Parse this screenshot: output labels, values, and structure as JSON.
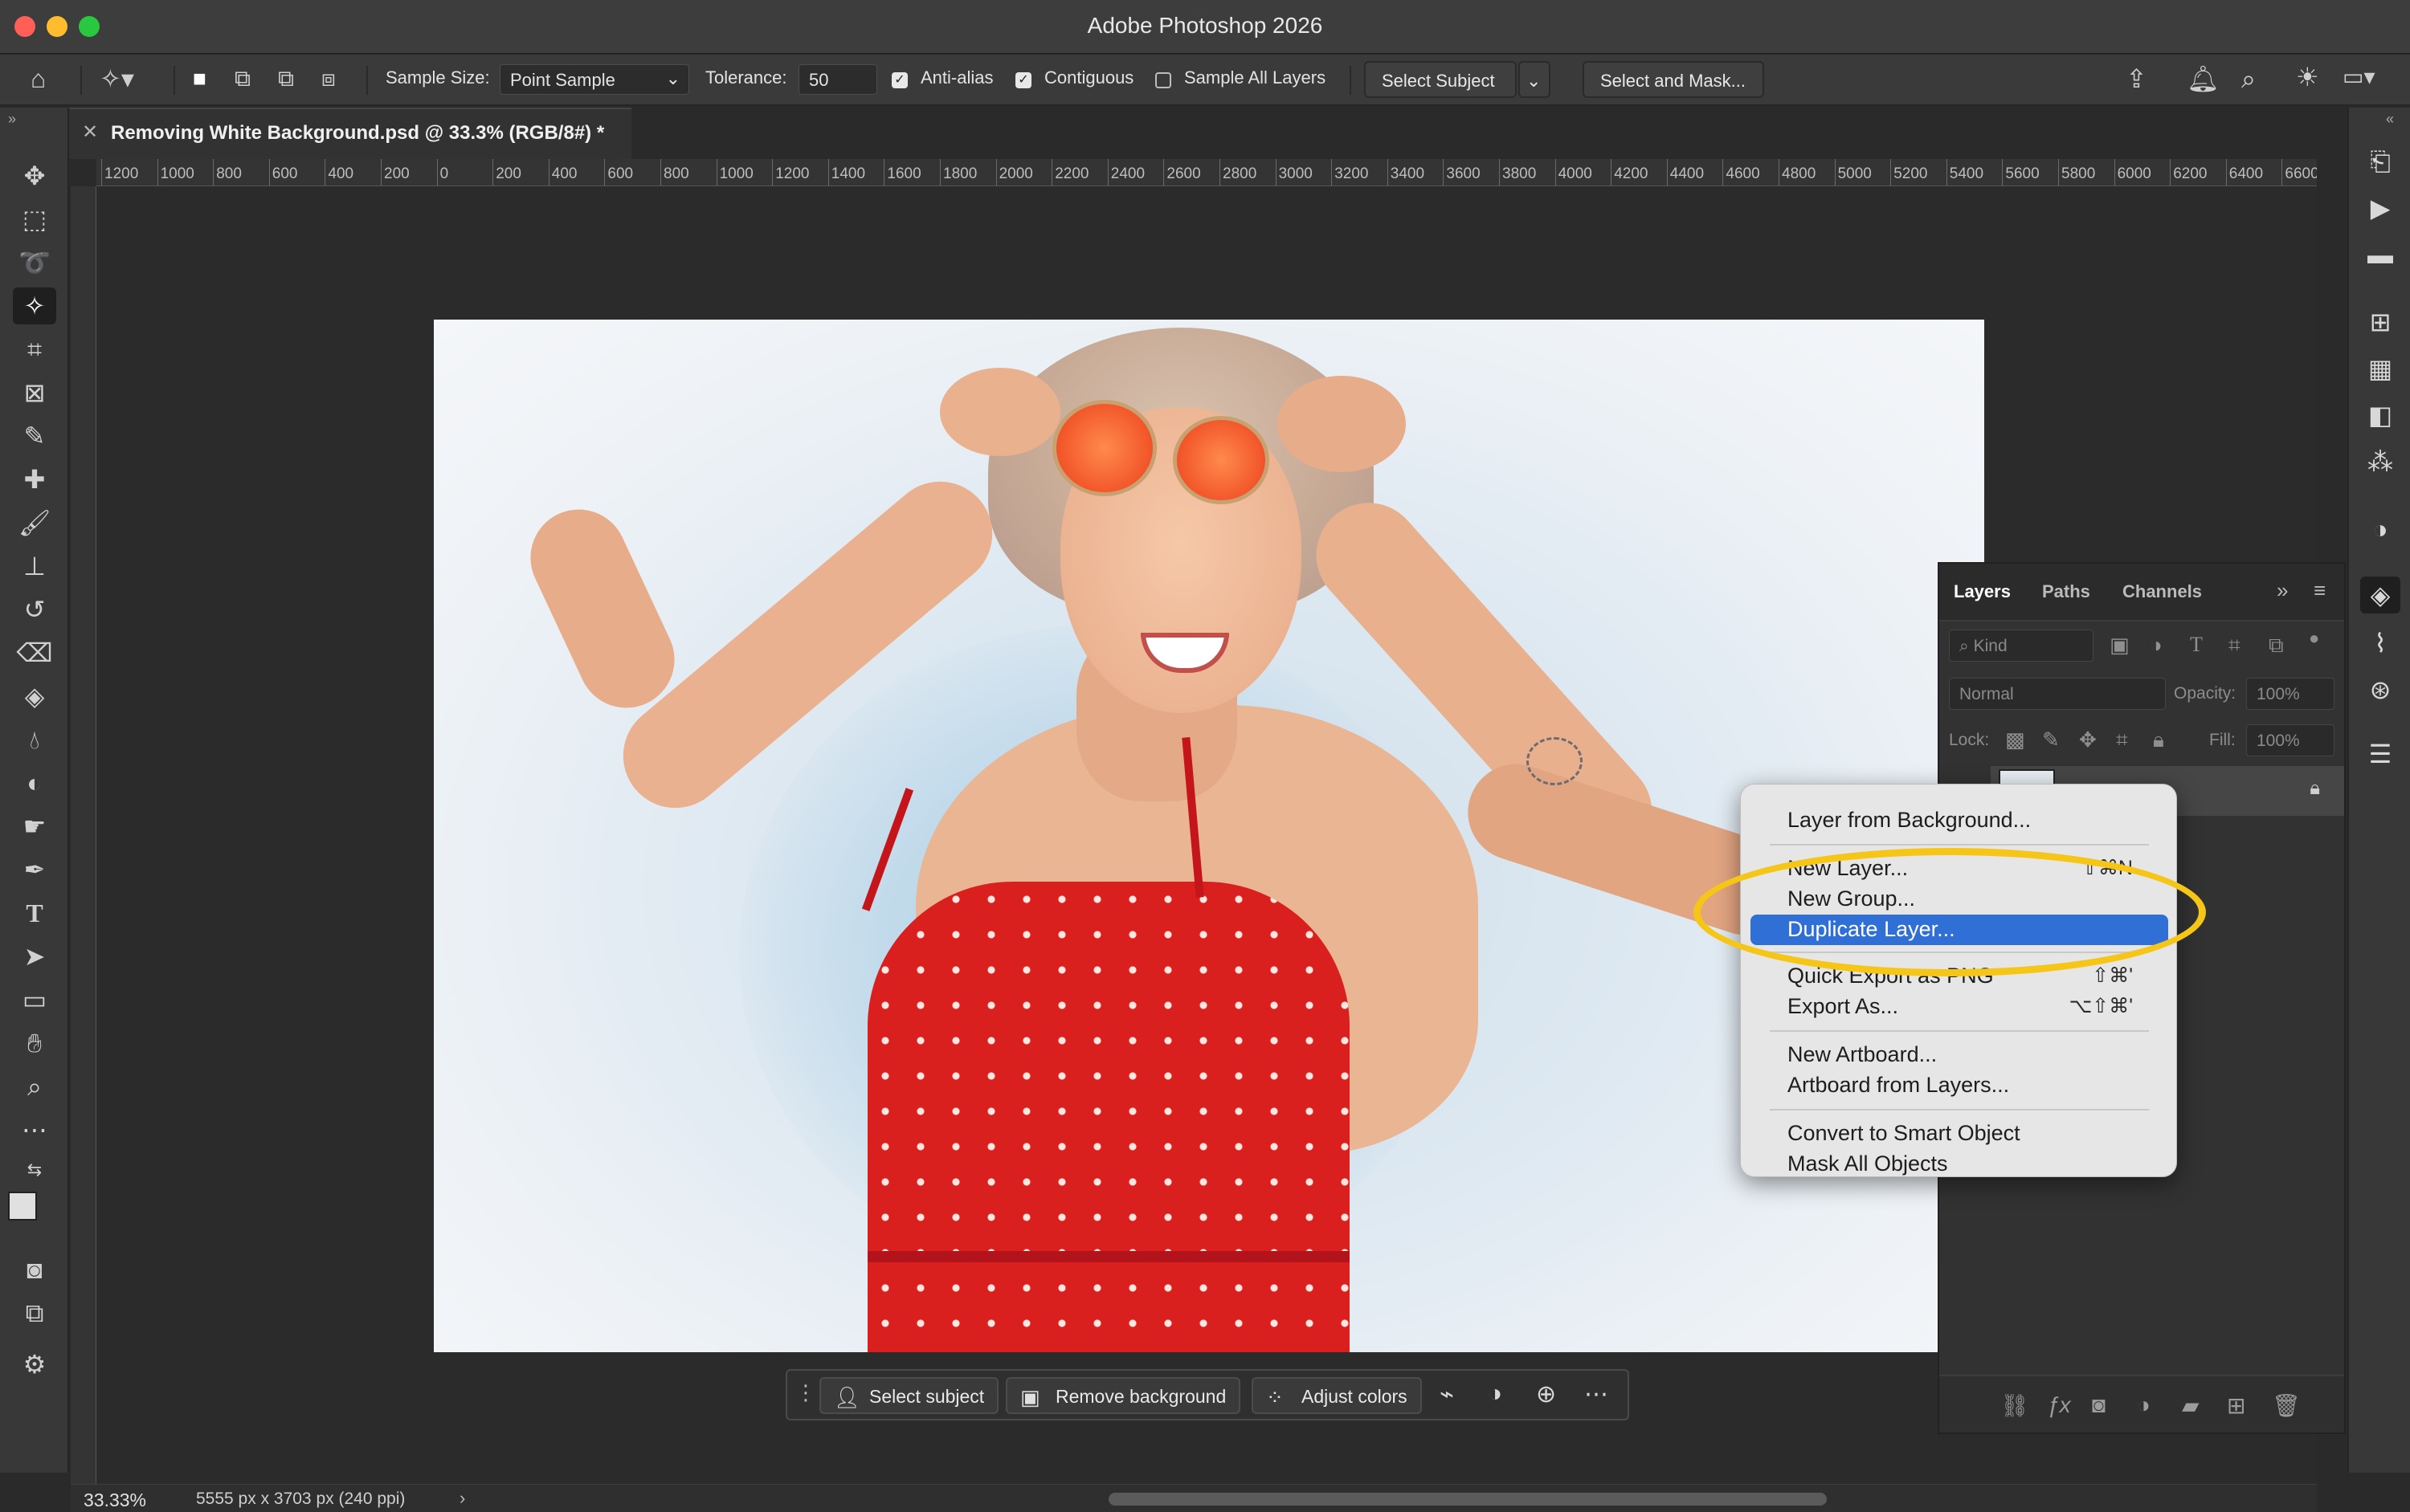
{
  "window": {
    "title": "Adobe Photoshop 2026",
    "traffic_colors": [
      "#ff5f57",
      "#febc2e",
      "#28c840"
    ]
  },
  "options_bar": {
    "sample_size_label": "Sample Size:",
    "sample_size_value": "Point Sample",
    "tolerance_label": "Tolerance:",
    "tolerance_value": "50",
    "anti_alias_label": "Anti-alias",
    "contiguous_label": "Contiguous",
    "sample_all_layers_label": "Sample All Layers",
    "select_subject_label": "Select Subject",
    "select_and_mask_label": "Select and Mask..."
  },
  "document": {
    "tab_title": "Removing White Background.psd @ 33.3% (RGB/8#) *"
  },
  "ruler": {
    "ticks": [
      "1200",
      "1000",
      "800",
      "600",
      "400",
      "200",
      "0",
      "200",
      "400",
      "600",
      "800",
      "1000",
      "1200",
      "1400",
      "1600",
      "1800",
      "2000",
      "2200",
      "2400",
      "2600",
      "2800",
      "3000",
      "3200",
      "3400",
      "3600",
      "3800",
      "4000",
      "4200",
      "4400",
      "4600",
      "4800",
      "5000",
      "5200",
      "5400",
      "5600",
      "5800",
      "6000",
      "6200",
      "6400",
      "6600"
    ]
  },
  "taskbar": {
    "select_subject": "Select subject",
    "remove_background": "Remove background",
    "adjust_colors": "Adjust colors"
  },
  "status": {
    "zoom": "33.33%",
    "doc_size": "5555 px x 3703 px (240 ppi)"
  },
  "layers_panel": {
    "tabs": [
      "Layers",
      "Paths",
      "Channels"
    ],
    "kind_placeholder": "Kind",
    "blend_mode": "Normal",
    "opacity_label": "Opacity:",
    "opacity_value": "100%",
    "lock_label": "Lock:",
    "fill_label": "Fill:",
    "fill_value": "100%"
  },
  "context_menu": {
    "items": [
      {
        "label": "Layer from Background...",
        "shortcut": ""
      },
      {
        "label": "New Layer...",
        "shortcut": "⇧⌘N"
      },
      {
        "label": "New Group...",
        "shortcut": ""
      },
      {
        "label": "Duplicate Layer...",
        "shortcut": ""
      },
      {
        "label": "Quick Export as PNG",
        "shortcut": "⇧⌘'"
      },
      {
        "label": "Export As...",
        "shortcut": "⌥⇧⌘'"
      },
      {
        "label": "New Artboard...",
        "shortcut": ""
      },
      {
        "label": "Artboard from Layers...",
        "shortcut": ""
      },
      {
        "label": "Convert to Smart Object",
        "shortcut": ""
      },
      {
        "label": "Mask All Objects",
        "shortcut": ""
      }
    ]
  },
  "colors": {
    "menu_highlight": "#2f6fd6",
    "annotation": "#f5c518",
    "dress": "#d9201f"
  }
}
